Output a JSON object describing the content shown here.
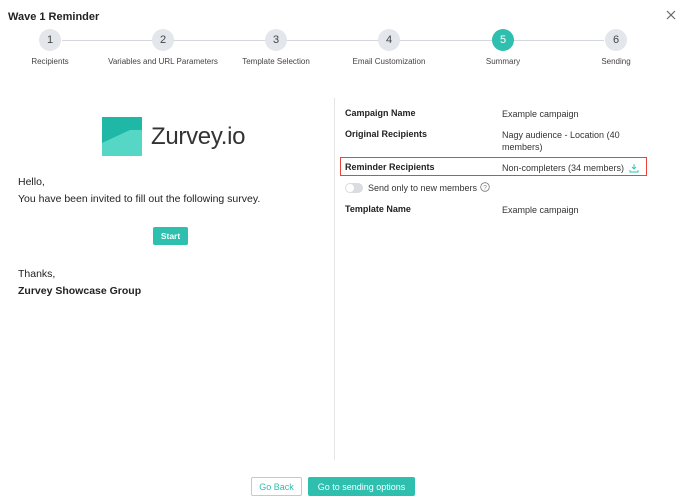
{
  "modal": {
    "title": "Wave 1 Reminder"
  },
  "stepper": {
    "steps": [
      {
        "number": "1",
        "label": "Recipients"
      },
      {
        "number": "2",
        "label": "Variables and URL Parameters"
      },
      {
        "number": "3",
        "label": "Template Selection"
      },
      {
        "number": "4",
        "label": "Email Customization"
      },
      {
        "number": "5",
        "label": "Summary"
      },
      {
        "number": "6",
        "label": "Sending"
      }
    ],
    "active_step": "5"
  },
  "email_preview": {
    "logo_text": "Zurvey.io",
    "greeting": "Hello,",
    "message": "You have been invited to fill out the following survey.",
    "start_label": "Start",
    "thanks": "Thanks,",
    "signature": "Zurvey Showcase Group"
  },
  "summary": {
    "campaign_name": {
      "label": "Campaign Name",
      "value": "Example campaign"
    },
    "original_recipients": {
      "label": "Original Recipients",
      "value": "Nagy audience - Location (40 members)"
    },
    "reminder_recipients": {
      "label": "Reminder Recipients",
      "value": "Non-completers (34 members)"
    },
    "send_only_new": {
      "label": "Send only to new members",
      "enabled": false
    },
    "template_name": {
      "label": "Template Name",
      "value": "Example campaign"
    }
  },
  "footer": {
    "back_label": "Go Back",
    "next_label": "Go to sending options"
  },
  "colors": {
    "accent": "#2ebfae",
    "highlight_border": "#e8443a",
    "inactive_step": "#e3e6ea"
  }
}
